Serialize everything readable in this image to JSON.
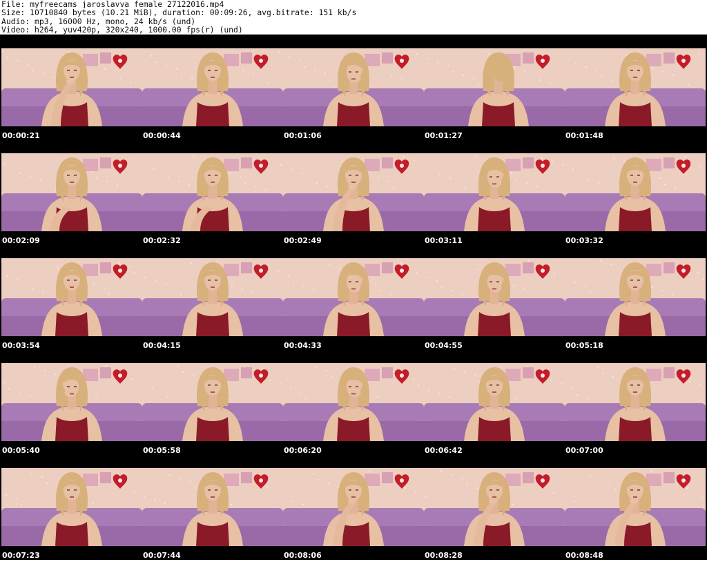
{
  "header": {
    "file_line": "File: myfreecams_jaroslavva_female_27122016.mp4",
    "size_line": "Size: 10710840 bytes (10.21 MiB), duration: 00:09:26, avg.bitrate: 151 kb/s",
    "audio_line": "Audio: mp3, 16000 Hz, mono, 24 kb/s (und)",
    "video_line": "Video: h264, yuv420p, 320x240, 1000.00 fps(r) (und)"
  },
  "colors": {
    "background": "#000000",
    "header_background": "#ffffff",
    "wall": "#eccfc0",
    "couch": "#9a6aa8",
    "top": "#8a1a28",
    "hair": "#d8b07c",
    "skin": "#e8c0a4",
    "heart": "#c41c28"
  },
  "frames": [
    {
      "time": "00:00:21",
      "pose": "hand-chin"
    },
    {
      "time": "00:00:44",
      "pose": "arms-down"
    },
    {
      "time": "00:01:06",
      "pose": "head-down"
    },
    {
      "time": "00:01:27",
      "pose": "turned-away"
    },
    {
      "time": "00:01:48",
      "pose": "arms-down"
    },
    {
      "time": "00:02:09",
      "pose": "hand-chest"
    },
    {
      "time": "00:02:32",
      "pose": "hand-chest"
    },
    {
      "time": "00:02:49",
      "pose": "hand-chin"
    },
    {
      "time": "00:03:11",
      "pose": "head-down"
    },
    {
      "time": "00:03:32",
      "pose": "arms-down"
    },
    {
      "time": "00:03:54",
      "pose": "arms-down"
    },
    {
      "time": "00:04:15",
      "pose": "arms-down"
    },
    {
      "time": "00:04:33",
      "pose": "head-down"
    },
    {
      "time": "00:04:55",
      "pose": "head-down"
    },
    {
      "time": "00:05:18",
      "pose": "arms-down"
    },
    {
      "time": "00:05:40",
      "pose": "head-tilt"
    },
    {
      "time": "00:05:58",
      "pose": "arms-down"
    },
    {
      "time": "00:06:20",
      "pose": "head-down"
    },
    {
      "time": "00:06:42",
      "pose": "arms-down"
    },
    {
      "time": "00:07:00",
      "pose": "arms-down"
    },
    {
      "time": "00:07:23",
      "pose": "arms-down"
    },
    {
      "time": "00:07:44",
      "pose": "arms-down"
    },
    {
      "time": "00:08:06",
      "pose": "hand-chin"
    },
    {
      "time": "00:08:28",
      "pose": "hand-chin"
    },
    {
      "time": "00:08:48",
      "pose": "hand-chin"
    }
  ]
}
